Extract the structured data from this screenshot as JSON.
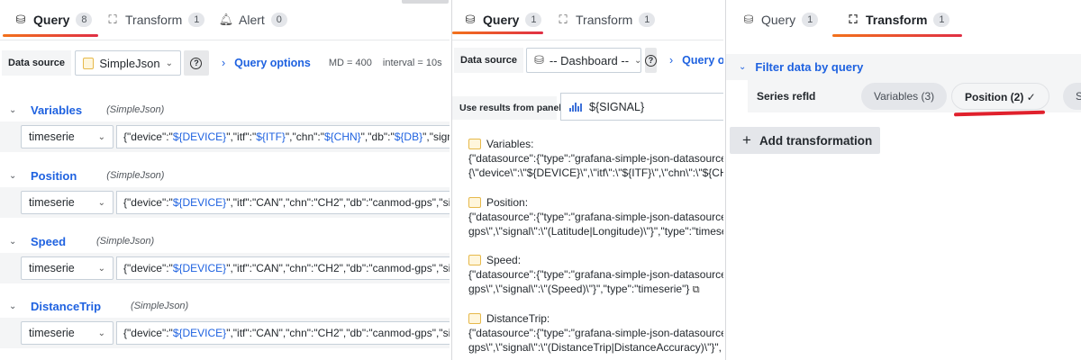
{
  "panel1": {
    "tabs": [
      {
        "label": "Query",
        "count": "8"
      },
      {
        "label": "Transform",
        "count": "1"
      },
      {
        "label": "Alert",
        "count": "0"
      }
    ],
    "datasource": {
      "label": "Data source",
      "value": "SimpleJson",
      "query_options": "Query options",
      "md": "MD = 400",
      "interval": "interval = 10s"
    },
    "queries": [
      {
        "refid": "Variables",
        "ds": "(SimpleJson)",
        "type": "timeserie",
        "t1": "{\"device\":\"",
        "v1": "${DEVICE}",
        "t2": "\",\"itf\":\"",
        "v2": "${ITF}",
        "t3": "\",\"chn\":\"",
        "v3": "${CHN}",
        "t4": "\",\"db\":\"",
        "v4": "${DB}",
        "t5": "\",\"signal\":\"",
        "v5": "$"
      },
      {
        "refid": "Position",
        "ds": "(SimpleJson)",
        "type": "timeserie",
        "t1": "{\"device\":\"",
        "v1": "${DEVICE}",
        "t2": "\",\"itf\":\"CAN\",\"chn\":\"CH2\",\"db\":\"canmod-gps\",\"signal\""
      },
      {
        "refid": "Speed",
        "ds": "(SimpleJson)",
        "type": "timeserie",
        "t1": "{\"device\":\"",
        "v1": "${DEVICE}",
        "t2": "\",\"itf\":\"CAN\",\"chn\":\"CH2\",\"db\":\"canmod-gps\",\"signal\""
      },
      {
        "refid": "DistanceTrip",
        "ds": "(SimpleJson)",
        "type": "timeserie",
        "t1": "{\"device\":\"",
        "v1": "${DEVICE}",
        "t2": "\",\"itf\":\"CAN\",\"chn\":\"CH2\",\"db\":\"canmod-gps\",\"signal\""
      }
    ]
  },
  "panel2": {
    "tabs": [
      {
        "label": "Query",
        "count": "1"
      },
      {
        "label": "Transform",
        "count": "1"
      }
    ],
    "datasource": {
      "label": "Data source",
      "value": "-- Dashboard --",
      "query_options": "Query o"
    },
    "use_results_label": "Use results from panel",
    "use_results_value": "${SIGNAL}",
    "results": [
      {
        "name": "Variables:",
        "line1": "{\"datasource\":{\"type\":\"grafana-simple-json-datasource\"",
        "line2": "{\\\"device\\\":\\\"${DEVICE}\\\",\\\"itf\\\":\\\"${ITF}\\\",\\\"chn\\\":\\\"${CH"
      },
      {
        "name": "Position:",
        "line1": "{\"datasource\":{\"type\":\"grafana-simple-json-datasource\"",
        "line2": "gps\\\",\\\"signal\\\":\\\"(Latitude|Longitude)\\\"}\",\"type\":\"timese"
      },
      {
        "name": "Speed:",
        "line1": "{\"datasource\":{\"type\":\"grafana-simple-json-datasource\"",
        "line2": "gps\\\",\\\"signal\\\":\\\"(Speed)\\\"}\",\"type\":\"timeserie\"}"
      },
      {
        "name": "DistanceTrip:",
        "line1": "{\"datasource\":{\"type\":\"grafana-simple-json-datasource\"",
        "line2": "gps\\\",\\\"signal\\\":\\\"(DistanceTrip|DistanceAccuracy)\\\"}\","
      }
    ]
  },
  "panel3": {
    "tabs": [
      {
        "label": "Query",
        "count": "1"
      },
      {
        "label": "Transform",
        "count": "1"
      }
    ],
    "filter_title": "Filter data by query",
    "series_label": "Series refId",
    "pills": [
      {
        "label": "Variables (3)"
      },
      {
        "label": "Position (2) ✓"
      },
      {
        "label": "Spe"
      }
    ],
    "add_transformation": "Add transformation"
  },
  "colors": {
    "accent": "#1f62e0",
    "tab_underline_start": "#f2711c",
    "tab_underline_end": "#e02f44",
    "annotation_red": "#e0202c"
  },
  "icons": {
    "query": "database-icon",
    "transform": "transform-icon",
    "alert": "bell-icon"
  }
}
